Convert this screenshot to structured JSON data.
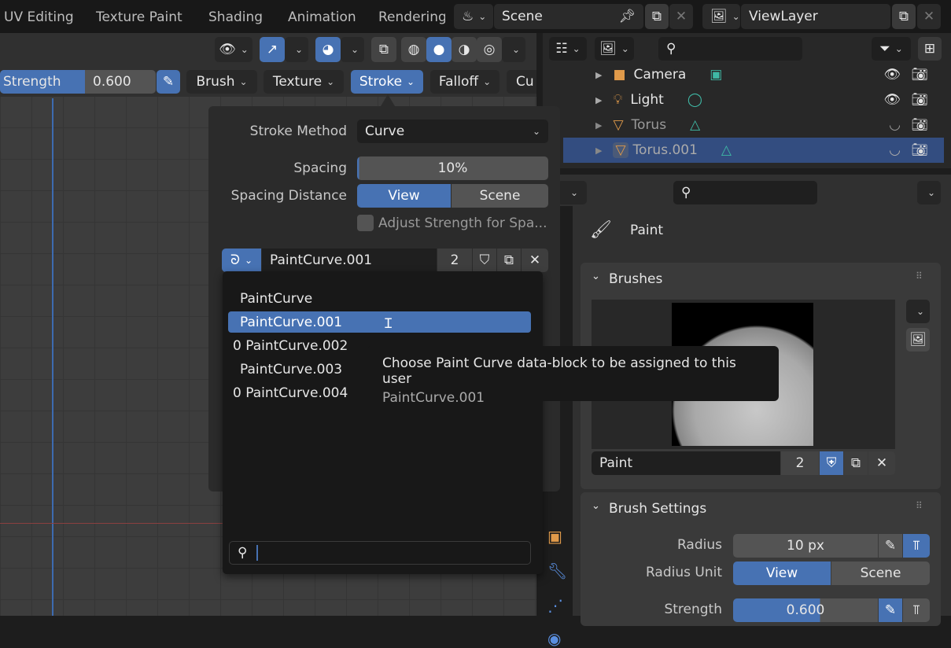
{
  "topbar": {
    "workspaces": [
      "UV Editing",
      "Texture Paint",
      "Shading",
      "Animation",
      "Rendering"
    ],
    "scene": "Scene",
    "view_layer": "ViewLayer"
  },
  "toolbar": {
    "strength_label": "Strength",
    "strength_value": "0.600",
    "menus": [
      "Brush",
      "Texture",
      "Stroke",
      "Falloff",
      "Cu"
    ]
  },
  "outliner": {
    "items": [
      {
        "name": "Camera",
        "visible": true
      },
      {
        "name": "Light",
        "visible": true
      },
      {
        "name": "Torus",
        "visible": false
      },
      {
        "name": "Torus.001",
        "visible": false,
        "selected": true
      }
    ]
  },
  "stroke_popover": {
    "stroke_method_label": "Stroke Method",
    "stroke_method": "Curve",
    "spacing_label": "Spacing",
    "spacing": "10%",
    "spacing_value": 0.1,
    "spacing_distance_label": "Spacing Distance",
    "view": "View",
    "scene": "Scene",
    "adjust_strength": "Adjust Strength for Spa...",
    "paint_curve": "PaintCurve.001",
    "users": "2"
  },
  "dropdown": {
    "items": [
      {
        "label": "PaintCurve",
        "prefix": ""
      },
      {
        "label": "PaintCurve.001",
        "prefix": "",
        "selected": true
      },
      {
        "label": "PaintCurve.002",
        "prefix": "0"
      },
      {
        "label": "PaintCurve.003",
        "prefix": ""
      },
      {
        "label": "PaintCurve.004",
        "prefix": "0"
      }
    ],
    "search_value": ""
  },
  "tooltip": {
    "line1": "Choose Paint Curve data-block to be assigned to this user",
    "line2": "PaintCurve.001"
  },
  "properties": {
    "context": "Paint",
    "brushes_title": "Brushes",
    "brush_name": "Paint",
    "brush_users": "2",
    "brush_settings_title": "Brush Settings",
    "radius_label": "Radius",
    "radius": "10 px",
    "radius_unit_label": "Radius Unit",
    "view": "View",
    "scene": "Scene",
    "strength_label": "Strength",
    "strength": "0.600",
    "strength_value": 0.6
  },
  "colors": {
    "accent": "#4772b3",
    "selected_row": "#334d80",
    "background": "#1d1d1d"
  }
}
